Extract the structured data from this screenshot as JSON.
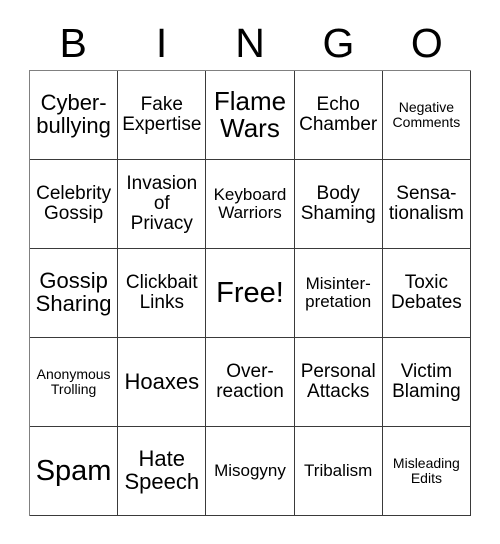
{
  "card": {
    "title": "BINGO",
    "header_letters": [
      "B",
      "I",
      "N",
      "G",
      "O"
    ],
    "free_space_label": "Free!",
    "colors": {
      "background": "#ffffff",
      "text": "#000000",
      "border": "#3a3a3a",
      "outer_border": "#808080"
    },
    "grid": {
      "columns": 5,
      "rows": 5
    },
    "cells": [
      {
        "text": "Cyber-\nbullying",
        "size": "lg",
        "row": 1,
        "col": 1,
        "free": false
      },
      {
        "text": "Fake\nExpertise",
        "size": "md",
        "row": 1,
        "col": 2,
        "free": false
      },
      {
        "text": "Flame\nWars",
        "size": "xl",
        "row": 1,
        "col": 3,
        "free": false
      },
      {
        "text": "Echo\nChamber",
        "size": "md",
        "row": 1,
        "col": 4,
        "free": false
      },
      {
        "text": "Negative\nComments",
        "size": "xs",
        "row": 1,
        "col": 5,
        "free": false
      },
      {
        "text": "Celebrity\nGossip",
        "size": "md",
        "row": 2,
        "col": 1,
        "free": false
      },
      {
        "text": "Invasion\nof\nPrivacy",
        "size": "md",
        "row": 2,
        "col": 2,
        "free": false
      },
      {
        "text": "Keyboard\nWarriors",
        "size": "sm",
        "row": 2,
        "col": 3,
        "free": false
      },
      {
        "text": "Body\nShaming",
        "size": "md",
        "row": 2,
        "col": 4,
        "free": false
      },
      {
        "text": "Sensa-\ntionalism",
        "size": "md",
        "row": 2,
        "col": 5,
        "free": false
      },
      {
        "text": "Gossip\nSharing",
        "size": "lg",
        "row": 3,
        "col": 1,
        "free": false
      },
      {
        "text": "Clickbait\nLinks",
        "size": "md",
        "row": 3,
        "col": 2,
        "free": false
      },
      {
        "text": "Free!",
        "size": "xxl",
        "row": 3,
        "col": 3,
        "free": true
      },
      {
        "text": "Misinter-\npretation",
        "size": "sm",
        "row": 3,
        "col": 4,
        "free": false
      },
      {
        "text": "Toxic\nDebates",
        "size": "md",
        "row": 3,
        "col": 5,
        "free": false
      },
      {
        "text": "Anonymous\nTrolling",
        "size": "xs",
        "row": 4,
        "col": 1,
        "free": false
      },
      {
        "text": "Hoaxes",
        "size": "lg",
        "row": 4,
        "col": 2,
        "free": false
      },
      {
        "text": "Over-\nreaction",
        "size": "md",
        "row": 4,
        "col": 3,
        "free": false
      },
      {
        "text": "Personal\nAttacks",
        "size": "md",
        "row": 4,
        "col": 4,
        "free": false
      },
      {
        "text": "Victim\nBlaming",
        "size": "md",
        "row": 4,
        "col": 5,
        "free": false
      },
      {
        "text": "Spam",
        "size": "xxl",
        "row": 5,
        "col": 1,
        "free": false
      },
      {
        "text": "Hate\nSpeech",
        "size": "lg",
        "row": 5,
        "col": 2,
        "free": false
      },
      {
        "text": "Misogyny",
        "size": "sm",
        "row": 5,
        "col": 3,
        "free": false
      },
      {
        "text": "Tribalism",
        "size": "sm",
        "row": 5,
        "col": 4,
        "free": false
      },
      {
        "text": "Misleading\nEdits",
        "size": "xs",
        "row": 5,
        "col": 5,
        "free": false
      }
    ]
  }
}
